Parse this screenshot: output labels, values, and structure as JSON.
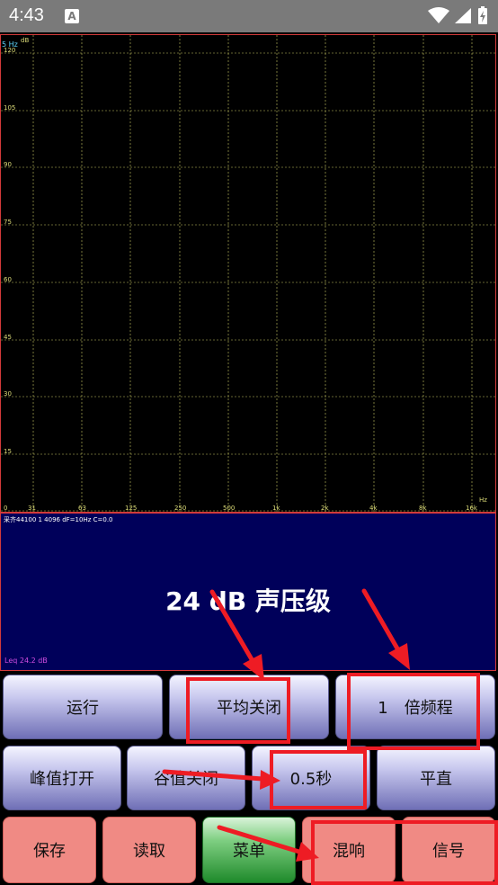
{
  "status_bar": {
    "time": "4:43",
    "notification_icon": "A"
  },
  "spectrum": {
    "freq_unit_label": "5 Hz",
    "db_unit_label": "dB",
    "y_ticks": [
      "120",
      "105",
      "90",
      "75",
      "60",
      "45",
      "30",
      "15",
      "0"
    ],
    "x_ticks": [
      "31",
      "63",
      "125",
      "250",
      "500",
      "1k",
      "2k",
      "4k",
      "8k",
      "16k"
    ],
    "x_unit": "Hz",
    "colors": {
      "grid": "#c8c864",
      "border": "#d23a3a",
      "background": "#000000"
    }
  },
  "info_panel": {
    "params": "采齐44100 1 4096 dF=10Hz C=0.0",
    "headline": "24 dB 声压级",
    "leq": "Leq 24.2 dB",
    "background": "#00005a"
  },
  "buttons": {
    "row1": {
      "run": "运行",
      "avg": "平均关闭",
      "octave": "1　倍频程"
    },
    "row2": {
      "peak": "峰值打开",
      "valley": "谷值关闭",
      "time": "0.5秒",
      "flat": "平直"
    },
    "row3": {
      "save": "保存",
      "read": "读取",
      "menu": "菜单",
      "reverb": "混响",
      "signal": "信号"
    }
  },
  "annotation_color": "#ee1c24"
}
